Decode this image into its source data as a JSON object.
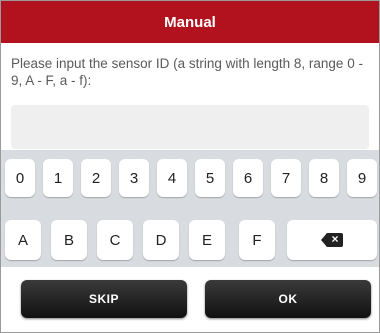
{
  "dialog": {
    "title": "Manual",
    "prompt": "Please input the sensor ID (a string with length 8, range 0 - 9, A - F, a - f):",
    "input_value": ""
  },
  "keyboard": {
    "row1": [
      "0",
      "1",
      "2",
      "3",
      "4",
      "5",
      "6",
      "7",
      "8",
      "9"
    ],
    "row2": [
      "A",
      "B",
      "C",
      "D",
      "E",
      "F"
    ],
    "backspace_icon": "backspace-icon"
  },
  "actions": {
    "skip_label": "SKIP",
    "ok_label": "OK"
  },
  "colors": {
    "header": "#b2121d",
    "keyboard_bg": "#d8dbe0",
    "button_bg": "#1a1a1a"
  }
}
